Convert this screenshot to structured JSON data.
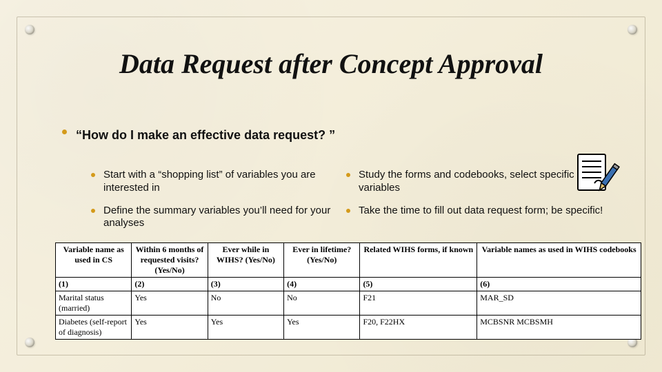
{
  "title": "Data Request after Concept Approval",
  "question": "“How do I make an effective data request? ”",
  "bullets_left": [
    "Start with a “shopping list” of variables you are interested in",
    "Define the summary variables you’ll need for your analyses"
  ],
  "bullets_right": [
    "Study the forms and codebooks, select specific variables",
    "Take the time to fill out data request form; be specific!"
  ],
  "clipart_name": "form-pen-icon",
  "table": {
    "headers": [
      "Variable name as used in CS",
      "Within 6 months of requested visits? (Yes/No)",
      "Ever while in WIHS? (Yes/No)",
      "Ever in lifetime? (Yes/No)",
      "Related WIHS forms, if known",
      "Variable names as used in WIHS codebooks"
    ],
    "colnums": [
      "(1)",
      "(2)",
      "(3)",
      "(4)",
      "(5)",
      "(6)"
    ],
    "rows": [
      {
        "name": "Marital status (married)",
        "c2": "Yes",
        "c3": "No",
        "c4": "No",
        "c5": "F21",
        "c6": "MAR_SD"
      },
      {
        "name": "Diabetes (self-report of diagnosis)",
        "c2": "Yes",
        "c3": "Yes",
        "c4": "Yes",
        "c5": "F20, F22HX",
        "c6": "MCBSNR  MCBSMH"
      }
    ]
  }
}
